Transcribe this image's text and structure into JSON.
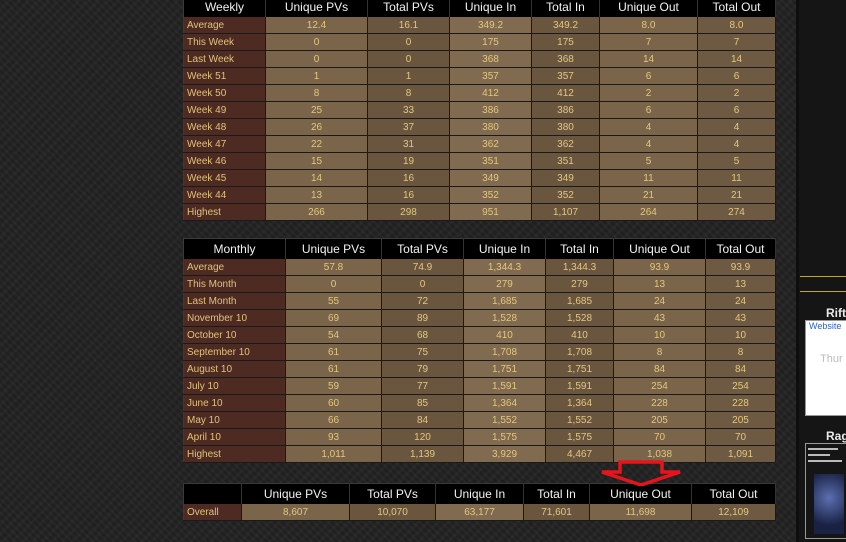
{
  "weekly": {
    "headers": [
      "Weekly",
      "Unique PVs",
      "Total PVs",
      "Unique In",
      "Total In",
      "Unique Out",
      "Total Out"
    ],
    "rows": [
      [
        "Average",
        "12.4",
        "16.1",
        "349.2",
        "349.2",
        "8.0",
        "8.0"
      ],
      [
        "This Week",
        "0",
        "0",
        "175",
        "175",
        "7",
        "7"
      ],
      [
        "Last Week",
        "0",
        "0",
        "368",
        "368",
        "14",
        "14"
      ],
      [
        "Week 51",
        "1",
        "1",
        "357",
        "357",
        "6",
        "6"
      ],
      [
        "Week 50",
        "8",
        "8",
        "412",
        "412",
        "2",
        "2"
      ],
      [
        "Week 49",
        "25",
        "33",
        "386",
        "386",
        "6",
        "6"
      ],
      [
        "Week 48",
        "26",
        "37",
        "380",
        "380",
        "4",
        "4"
      ],
      [
        "Week 47",
        "22",
        "31",
        "362",
        "362",
        "4",
        "4"
      ],
      [
        "Week 46",
        "15",
        "19",
        "351",
        "351",
        "5",
        "5"
      ],
      [
        "Week 45",
        "14",
        "16",
        "349",
        "349",
        "11",
        "11"
      ],
      [
        "Week 44",
        "13",
        "16",
        "352",
        "352",
        "21",
        "21"
      ],
      [
        "Highest",
        "266",
        "298",
        "951",
        "1,107",
        "264",
        "274"
      ]
    ]
  },
  "monthly": {
    "headers": [
      "Monthly",
      "Unique PVs",
      "Total PVs",
      "Unique In",
      "Total In",
      "Unique Out",
      "Total Out"
    ],
    "rows": [
      [
        "Average",
        "57.8",
        "74.9",
        "1,344.3",
        "1,344.3",
        "93.9",
        "93.9"
      ],
      [
        "This Month",
        "0",
        "0",
        "279",
        "279",
        "13",
        "13"
      ],
      [
        "Last Month",
        "55",
        "72",
        "1,685",
        "1,685",
        "24",
        "24"
      ],
      [
        "November 10",
        "69",
        "89",
        "1,528",
        "1,528",
        "43",
        "43"
      ],
      [
        "October 10",
        "54",
        "68",
        "410",
        "410",
        "10",
        "10"
      ],
      [
        "September 10",
        "61",
        "75",
        "1,708",
        "1,708",
        "8",
        "8"
      ],
      [
        "August 10",
        "61",
        "79",
        "1,751",
        "1,751",
        "84",
        "84"
      ],
      [
        "July 10",
        "59",
        "77",
        "1,591",
        "1,591",
        "254",
        "254"
      ],
      [
        "June 10",
        "60",
        "85",
        "1,364",
        "1,364",
        "228",
        "228"
      ],
      [
        "May 10",
        "66",
        "84",
        "1,552",
        "1,552",
        "205",
        "205"
      ],
      [
        "April 10",
        "93",
        "120",
        "1,575",
        "1,575",
        "70",
        "70"
      ],
      [
        "Highest",
        "1,011",
        "1,139",
        "3,929",
        "4,467",
        "1,038",
        "1,091"
      ]
    ]
  },
  "overall": {
    "headers": [
      "",
      "Unique PVs",
      "Total PVs",
      "Unique In",
      "Total In",
      "Unique Out",
      "Total Out"
    ],
    "rows": [
      [
        "Overall",
        "8,607",
        "10,070",
        "63,177",
        "71,601",
        "11,698",
        "12,109"
      ]
    ]
  },
  "sidebar": {
    "item1_title": "Rift",
    "item1_link": "Website",
    "item1_faded": "Thur",
    "item2_title": "Rag"
  },
  "annotation": {
    "arrow_color": "#e8141b"
  }
}
